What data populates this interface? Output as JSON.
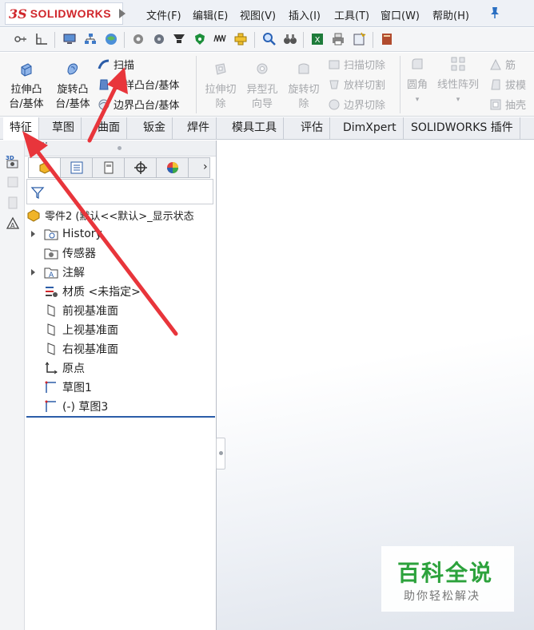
{
  "app": {
    "logo_prefix": "3S",
    "logo_text": "SOLIDWORKS"
  },
  "menu": [
    "文件(F)",
    "编辑(E)",
    "视图(V)",
    "插入(I)",
    "工具(T)",
    "窗口(W)",
    "帮助(H)"
  ],
  "commands": {
    "extrude_boss": [
      "拉伸凸",
      "台/基体"
    ],
    "revolve_boss": [
      "旋转凸",
      "台/基体"
    ],
    "sweep": "扫描",
    "loft_boss": "放样凸台/基体",
    "boundary_boss": "边界凸台/基体",
    "extrude_cut": [
      "拉伸切",
      "除"
    ],
    "hole_wizard": [
      "异型孔",
      "向导"
    ],
    "revolve_cut": [
      "旋转切",
      "除"
    ],
    "swept_cut": "扫描切除",
    "lofted_cut": "放样切割",
    "boundary_cut": "边界切除",
    "fillet": "圆角",
    "linear_pattern": "线性阵列",
    "rib": "筋",
    "draft": "拔模",
    "shell": "抽壳"
  },
  "tabs": [
    "特征",
    "草图",
    "曲面",
    "钣金",
    "焊件",
    "模具工具",
    "评估",
    "DimXpert",
    "SOLIDWORKS 插件"
  ],
  "feature_tree": {
    "root": "零件2 (默认<<默认>_显示状态",
    "items": [
      "History",
      "传感器",
      "注解",
      "材质 <未指定>",
      "前视基准面",
      "上视基准面",
      "右视基准面",
      "原点",
      "草图1",
      "(-) 草图3"
    ]
  },
  "watermark": {
    "title": "百科全说",
    "subtitle": "助你轻松解决"
  },
  "colors": {
    "brand_red": "#d0262b",
    "arrow_red": "#e8353b",
    "watermark_green": "#2ca23c"
  }
}
